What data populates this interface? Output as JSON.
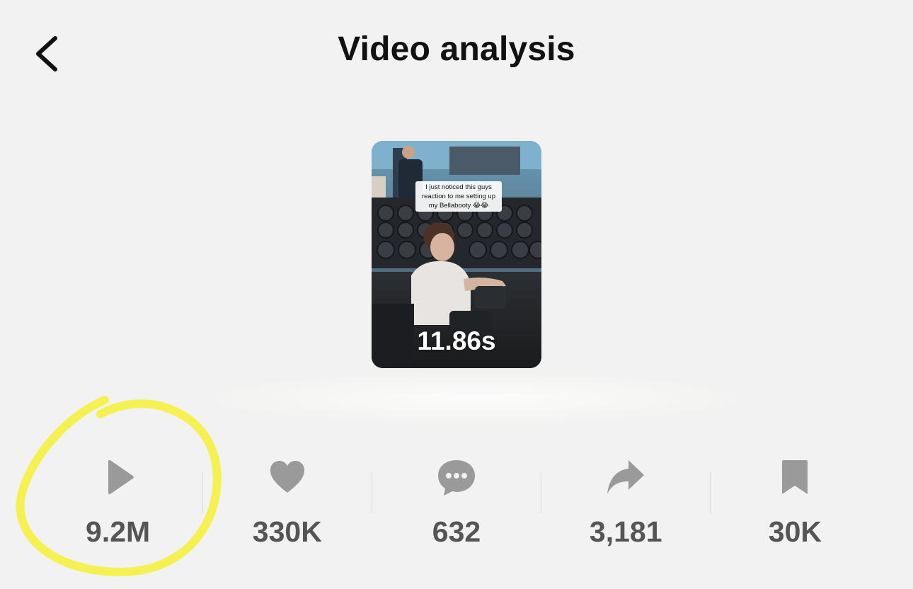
{
  "header": {
    "title": "Video analysis"
  },
  "video": {
    "caption": "I just noticed this guys reaction to me setting up my Bellabooty 😂😂",
    "duration": "11.86s"
  },
  "stats": [
    {
      "icon": "play-icon",
      "value": "9.2M"
    },
    {
      "icon": "heart-icon",
      "value": "330K"
    },
    {
      "icon": "comment-icon",
      "value": "632"
    },
    {
      "icon": "share-icon",
      "value": "3,181"
    },
    {
      "icon": "bookmark-icon",
      "value": "30K"
    }
  ],
  "colors": {
    "background": "#f2f2f2",
    "icon": "#9a9a9a",
    "value_text": "#555555",
    "highlight": "#f5f04a"
  }
}
